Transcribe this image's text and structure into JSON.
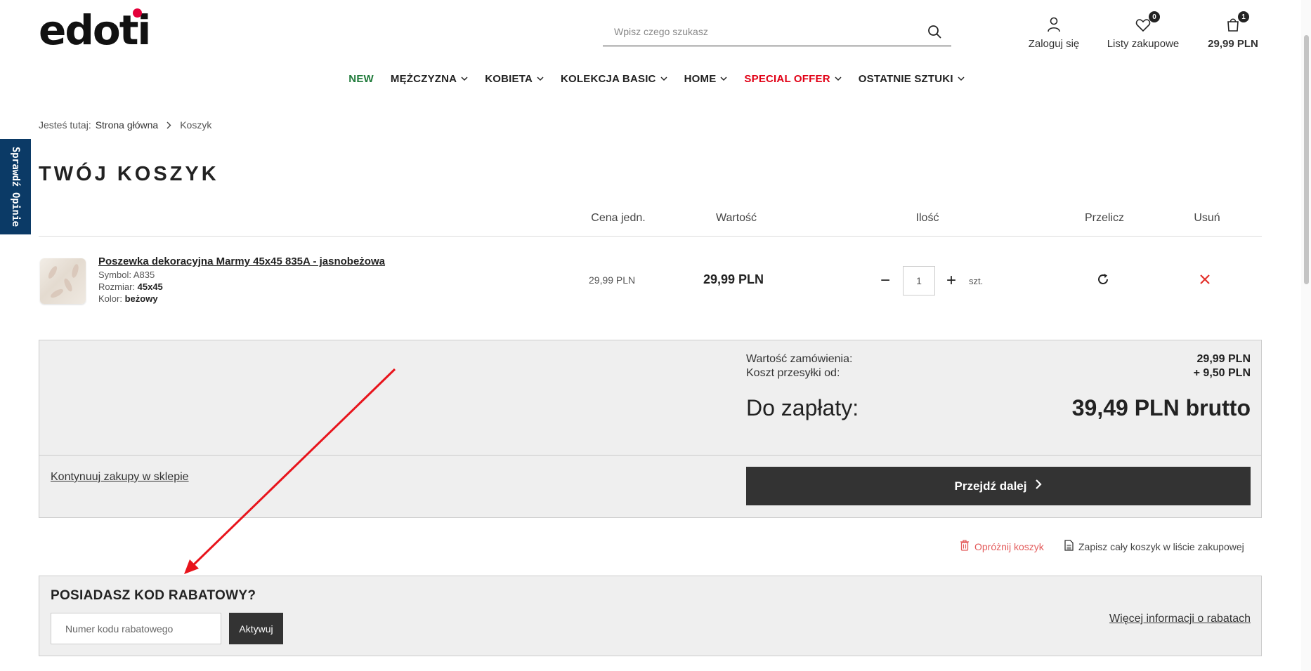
{
  "header": {
    "logo": "edoti",
    "search_placeholder": "Wpisz czego szukasz",
    "login_label": "Zaloguj się",
    "wishlist_label": "Listy zakupowe",
    "wishlist_count": "0",
    "cart_label": "29,99 PLN",
    "cart_count": "1"
  },
  "nav": {
    "items": [
      {
        "label": "NEW"
      },
      {
        "label": "MĘŻCZYZNA"
      },
      {
        "label": "KOBIETA"
      },
      {
        "label": "KOLEKCJA BASIC"
      },
      {
        "label": "HOME"
      },
      {
        "label": "SPECIAL OFFER"
      },
      {
        "label": "OSTATNIE SZTUKI"
      }
    ]
  },
  "side_tab": {
    "label": "Sprawdź Opinie"
  },
  "breadcrumb": {
    "prefix": "Jesteś tutaj:",
    "home": "Strona główna",
    "current": "Koszyk"
  },
  "page_title": "TWÓJ KOSZYK",
  "table": {
    "headers": {
      "unit_price": "Cena jedn.",
      "value": "Wartość",
      "qty": "Ilość",
      "recalc": "Przelicz",
      "remove": "Usuń"
    },
    "item": {
      "name": "Poszewka dekoracyjna Marmy 45x45 835A - jasnobeżowa",
      "symbol_label": "Symbol:",
      "symbol": "A835",
      "size_label": "Rozmiar:",
      "size": "45x45",
      "color_label": "Kolor:",
      "color": "beżowy",
      "unit_price": "29,99 PLN",
      "total": "29,99 PLN",
      "qty": "1",
      "unit": "szt."
    }
  },
  "summary": {
    "order_value_label": "Wartość zamówienia:",
    "order_value": "29,99 PLN",
    "shipping_label": "Koszt przesyłki od:",
    "shipping": "+ 9,50 PLN",
    "to_pay_label": "Do zapłaty:",
    "to_pay": "39,49 PLN brutto",
    "continue_link": "Kontynuuj zakupy w sklepie",
    "proceed_button": "Przejdź dalej"
  },
  "actions": {
    "empty_cart": "Opróżnij koszyk",
    "save_list": "Zapisz cały koszyk w liście zakupowej"
  },
  "coupon": {
    "title": "POSIADASZ KOD RABATOWY?",
    "placeholder": "Numer kodu rabatowego",
    "button": "Aktywuj",
    "more_info": "Więcej informacji o rabatach"
  },
  "colors": {
    "accent_red": "#e10015",
    "new_green": "#1f7a3a",
    "dark_button": "#333333",
    "side_tab_blue": "#0b3a66",
    "annotation_arrow": "#e8141c"
  }
}
